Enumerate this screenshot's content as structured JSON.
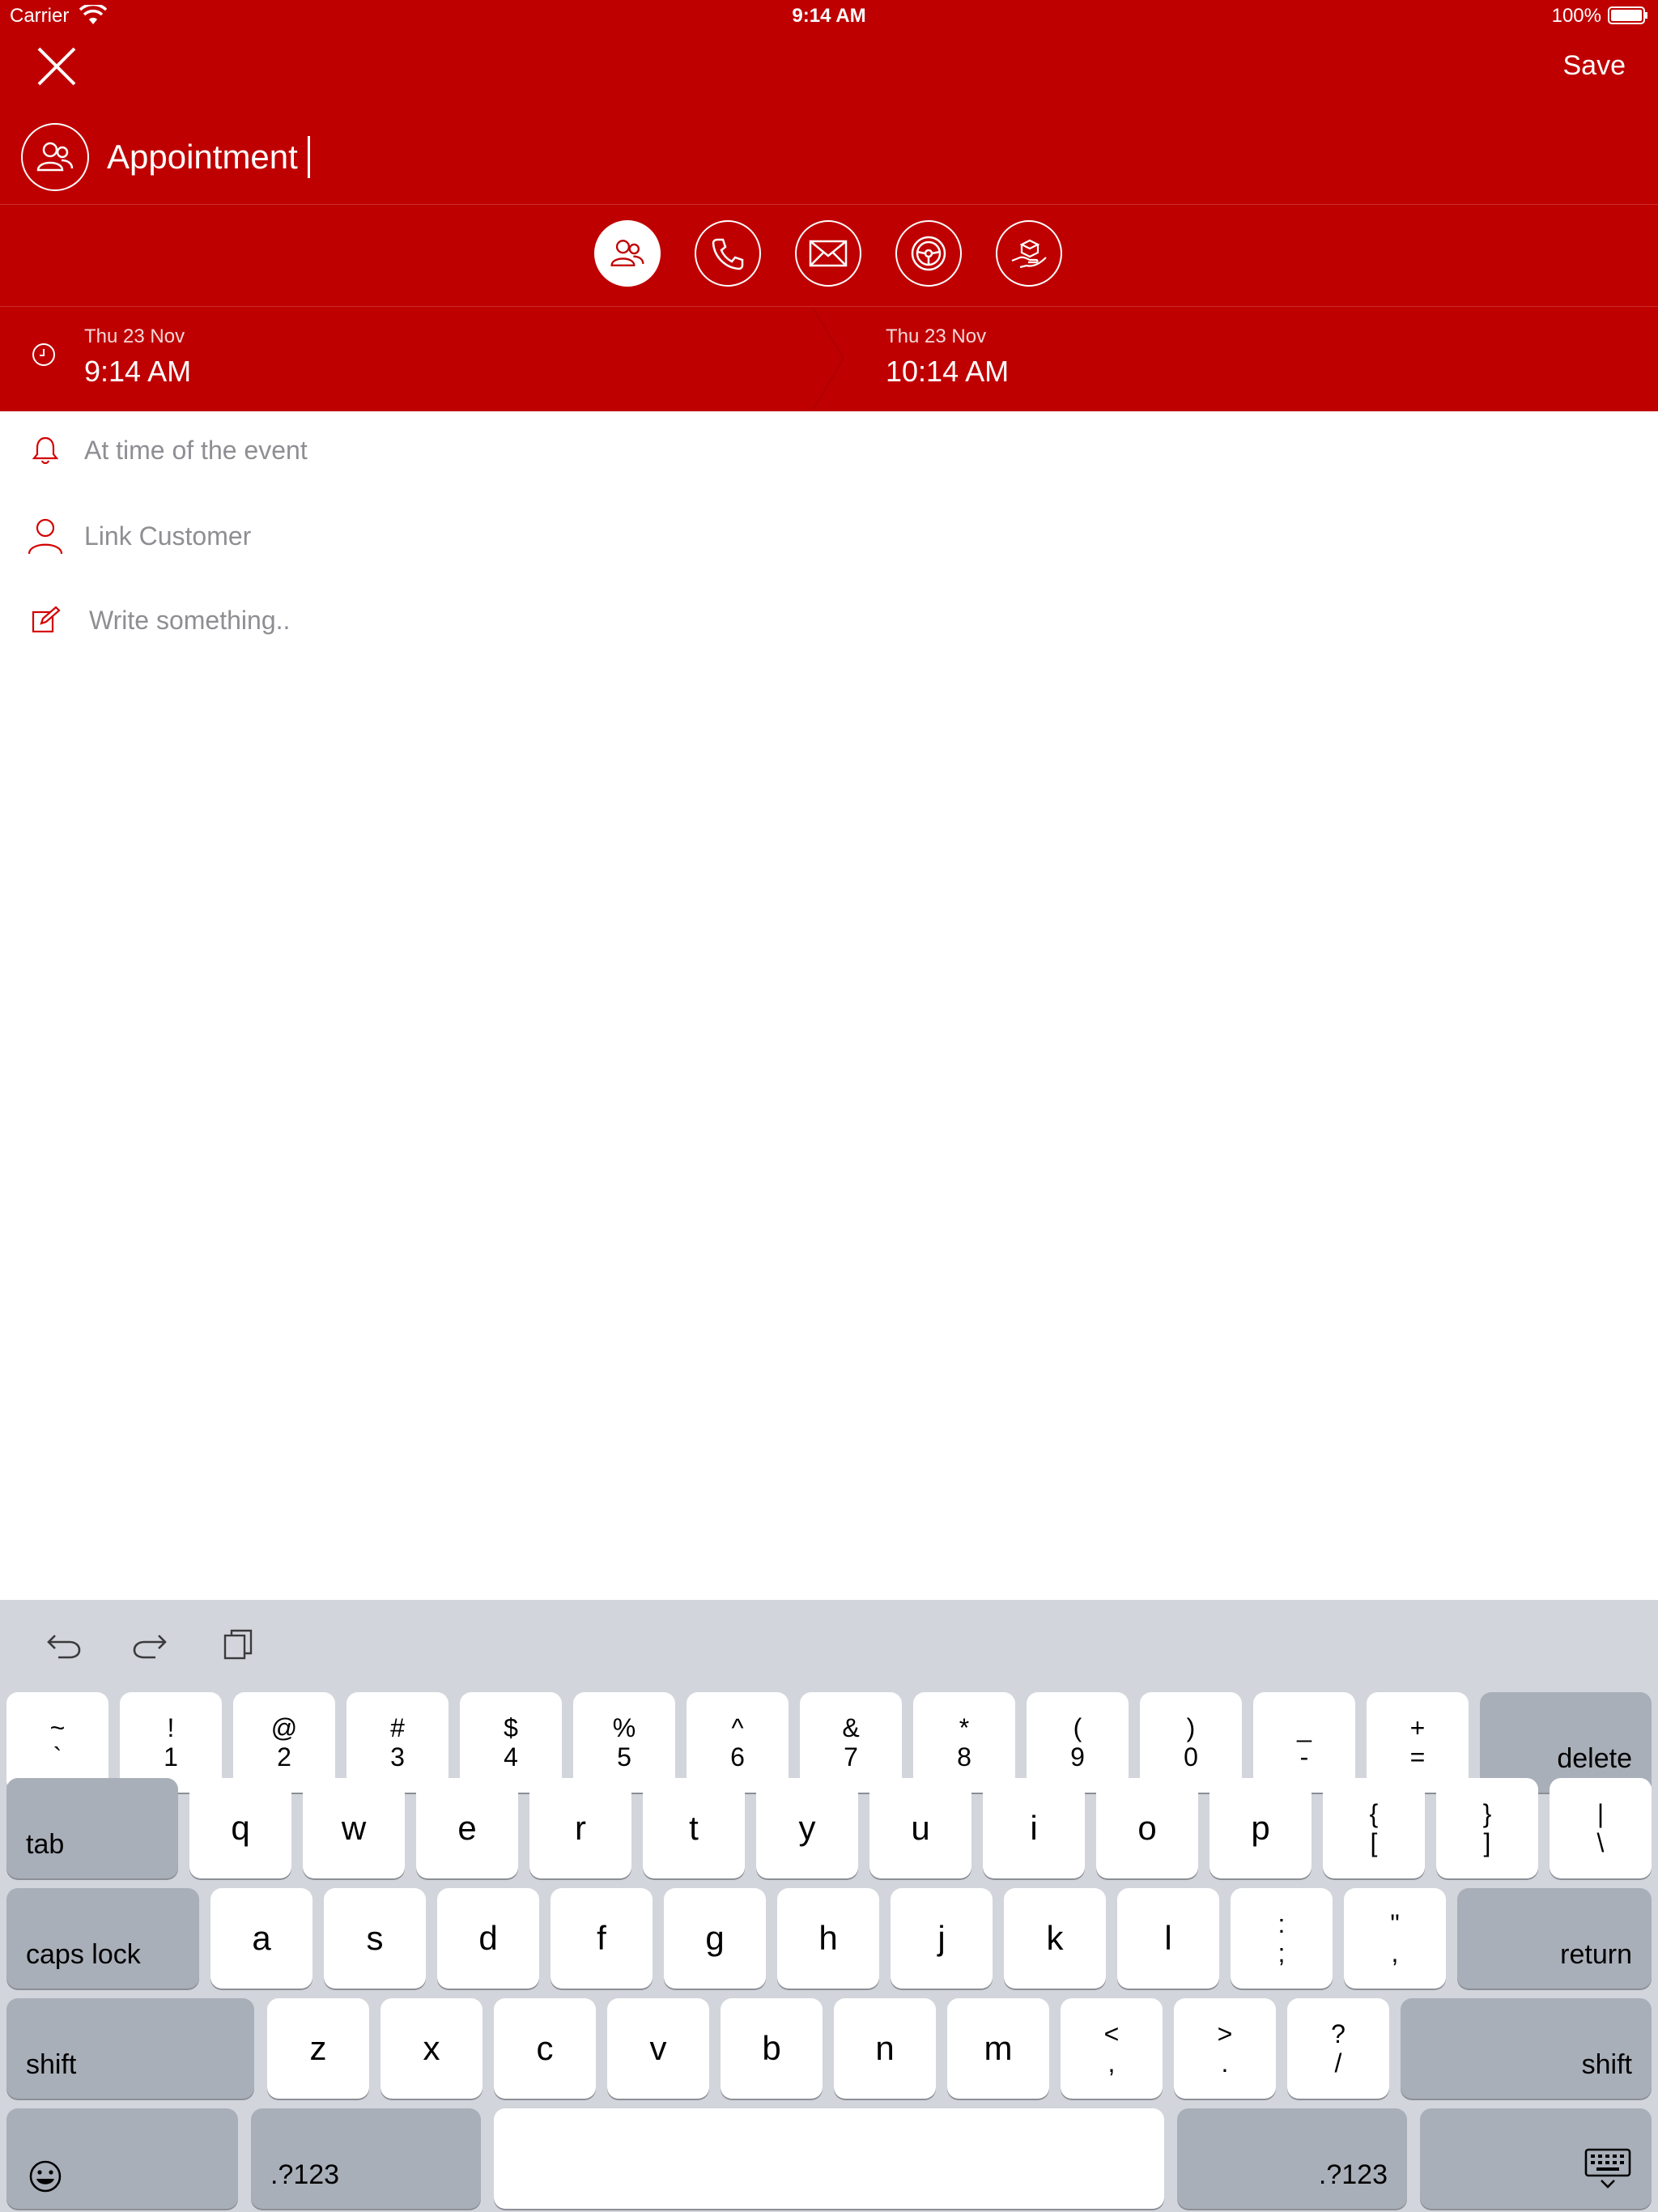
{
  "status_bar": {
    "carrier": "Carrier",
    "time": "9:14 AM",
    "battery": "100%"
  },
  "header": {
    "save_label": "Save",
    "title": "Appointment",
    "accent_color": "#bf0000",
    "event_types": [
      "appointment-icon",
      "phone-icon",
      "mail-icon",
      "steering-wheel-icon",
      "hand-box-icon"
    ],
    "start": {
      "date": "Thu 23 Nov",
      "time": "9:14 AM"
    },
    "end": {
      "date": "Thu 23 Nov",
      "time": "10:14 AM"
    }
  },
  "fields": {
    "alert": "At time of the event",
    "customer": "Link Customer",
    "note_placeholder": "Write something.."
  },
  "keyboard": {
    "row1": [
      [
        "~",
        "`"
      ],
      [
        "!",
        "1"
      ],
      [
        "@",
        "2"
      ],
      [
        "#",
        "3"
      ],
      [
        "$",
        "4"
      ],
      [
        "%",
        "5"
      ],
      [
        "^",
        "6"
      ],
      [
        "&",
        "7"
      ],
      [
        "*",
        "8"
      ],
      [
        "(",
        "9"
      ],
      [
        ")",
        "0"
      ],
      [
        "_",
        "-"
      ],
      [
        "+",
        "="
      ]
    ],
    "delete": "delete",
    "tab": "tab",
    "row2": [
      "q",
      "w",
      "e",
      "r",
      "t",
      "y",
      "u",
      "i",
      "o",
      "p"
    ],
    "row2_extra": [
      [
        "{",
        "["
      ],
      [
        "}",
        "]"
      ],
      [
        "|",
        "\\"
      ]
    ],
    "caps": "caps lock",
    "row3": [
      "a",
      "s",
      "d",
      "f",
      "g",
      "h",
      "j",
      "k",
      "l"
    ],
    "row3_extra": [
      [
        ":",
        ";"
      ],
      [
        "\"",
        ","
      ]
    ],
    "return": "return",
    "shift": "shift",
    "row4": [
      "z",
      "x",
      "c",
      "v",
      "b",
      "n",
      "m"
    ],
    "row4_extra": [
      [
        "<",
        ","
      ],
      [
        ">",
        "."
      ],
      [
        "?",
        "/"
      ]
    ],
    "numbers": ".?123"
  }
}
